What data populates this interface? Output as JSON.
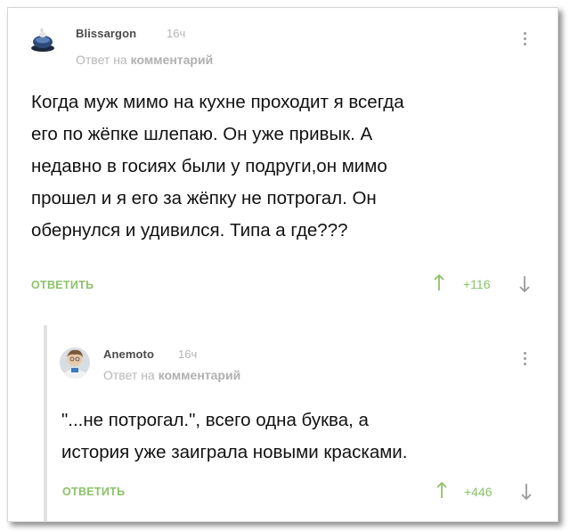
{
  "comments": [
    {
      "author": "Blissargon",
      "time": "16ч",
      "reply_to_prefix": "Ответ на",
      "reply_to_target": "комментарий",
      "text_lines": [
        "Когда муж мимо на кухне проходит я всегда",
        "его по жёпке шлепаю. Он уже привык. А",
        "недавно в госиях были у подруги,он мимо",
        "прошел и я его за жёпку не потрогал. Он",
        "обернулся и удивился. Типа а где???"
      ],
      "reply_label": "ОТВЕТИТЬ",
      "score": "+116"
    },
    {
      "author": "Anemoto",
      "time": "16ч",
      "reply_to_prefix": "Ответ на",
      "reply_to_target": "комментарий",
      "text_lines": [
        "\"...не потрогал.\", всего одна буква, а",
        "история уже заиграла новыми красками."
      ],
      "reply_label": "ОТВЕТИТЬ",
      "score": "+446"
    }
  ],
  "icons": {
    "upvote": "arrow-up-icon",
    "downvote": "arrow-down-icon",
    "more": "more-vertical-icon"
  },
  "colors": {
    "accent_green": "#8cc26a",
    "muted_gray": "#b5b5b5",
    "text": "#111111",
    "thread_line": "#e2e2e2"
  }
}
